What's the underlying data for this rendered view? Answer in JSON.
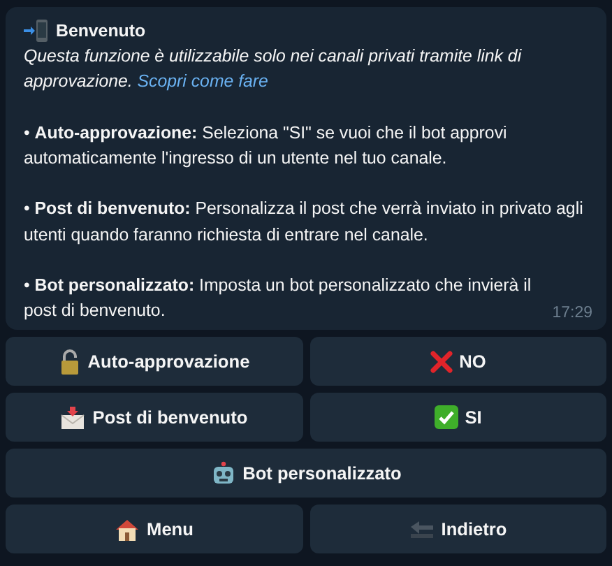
{
  "message": {
    "title": "Benvenuto",
    "intro": "Questa funzione è utilizzabile solo nei canali privati tramite link di approvazione.",
    "intro_link": "Scopri come fare",
    "bullets": [
      {
        "bullet": "•",
        "text": "**Auto-approvazione:** Seleziona \"SI\" se vuoi che il bot approvi automaticamente l'ingresso di un utente nel tuo canale."
      },
      {
        "bullet": "•",
        "text": "**Post di benvenuto:** Personalizza il post che verrà inviato in privato agli utenti quando faranno richiesta di entrare nel canale."
      },
      {
        "bullet": "•",
        "text": "**Bot personalizzato:** Imposta un bot personalizzato che invierà il post di benvenuto."
      }
    ],
    "time": "17:29"
  },
  "buttons": [
    [
      {
        "label": "Auto-approvazione"
      },
      {
        "label": "NO"
      }
    ],
    [
      {
        "label": "Post di benvenuto"
      },
      {
        "label": "SI"
      }
    ],
    [
      {
        "label": "Bot personalizzato"
      }
    ],
    [
      {
        "label": "Menu"
      },
      {
        "label": "Indietro"
      }
    ]
  ]
}
